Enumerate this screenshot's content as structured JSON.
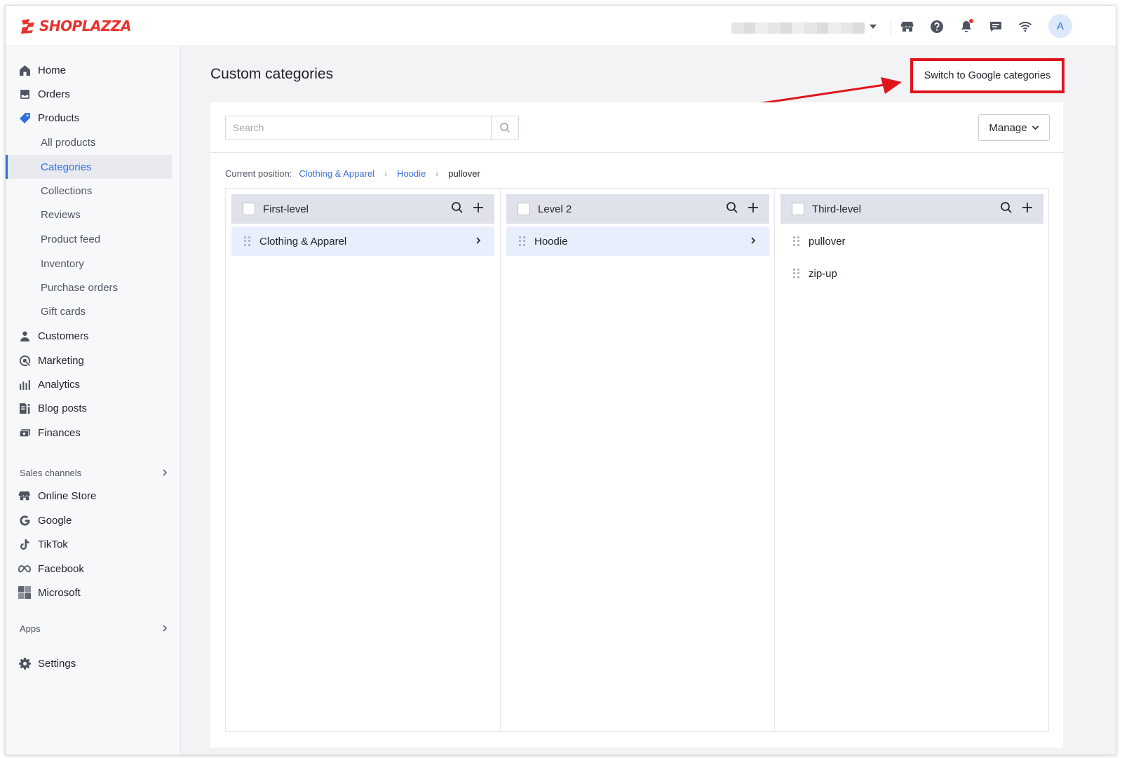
{
  "brand": {
    "name": "SHOPLAZZA",
    "color": "#e8322e"
  },
  "topbar": {
    "icons": [
      "store-icon",
      "help-icon",
      "bell-icon",
      "chat-icon",
      "wifi-icon"
    ],
    "avatar_initial": "A"
  },
  "sidebar": {
    "main": [
      {
        "label": "Home",
        "icon": "home-icon"
      },
      {
        "label": "Orders",
        "icon": "orders-icon"
      },
      {
        "label": "Products",
        "icon": "tag-icon"
      }
    ],
    "products_sub": [
      "All products",
      "Categories",
      "Collections",
      "Reviews",
      "Product feed",
      "Inventory",
      "Purchase orders",
      "Gift cards"
    ],
    "active_sub": "Categories",
    "main2": [
      {
        "label": "Customers",
        "icon": "person-icon"
      },
      {
        "label": "Marketing",
        "icon": "marketing-icon"
      },
      {
        "label": "Analytics",
        "icon": "analytics-icon"
      },
      {
        "label": "Blog posts",
        "icon": "blog-icon"
      },
      {
        "label": "Finances",
        "icon": "finances-icon"
      }
    ],
    "sales_channels_label": "Sales channels",
    "channels": [
      {
        "label": "Online Store",
        "icon": "store-icon"
      },
      {
        "label": "Google",
        "icon": "google-icon"
      },
      {
        "label": "TikTok",
        "icon": "tiktok-icon"
      },
      {
        "label": "Facebook",
        "icon": "meta-icon"
      },
      {
        "label": "Microsoft",
        "icon": "microsoft-icon"
      }
    ],
    "apps_label": "Apps",
    "settings_label": "Settings"
  },
  "main": {
    "title": "Custom categories",
    "switch_label": "Switch to Google categories",
    "search_placeholder": "Search",
    "manage_label": "Manage",
    "breadcrumb": {
      "prefix": "Current position:",
      "items": [
        "Clothing & Apparel",
        "Hoodie"
      ],
      "current": "pullover"
    },
    "columns": [
      {
        "title": "First-level",
        "items": [
          "Clothing & Apparel"
        ],
        "selected": 0
      },
      {
        "title": "Level 2",
        "items": [
          "Hoodie"
        ],
        "selected": 0
      },
      {
        "title": "Third-level",
        "items": [
          "pullover",
          "zip-up"
        ],
        "selected": -1
      }
    ]
  },
  "colors": {
    "accent": "#2f6fdb",
    "highlight": "#e0141c"
  }
}
